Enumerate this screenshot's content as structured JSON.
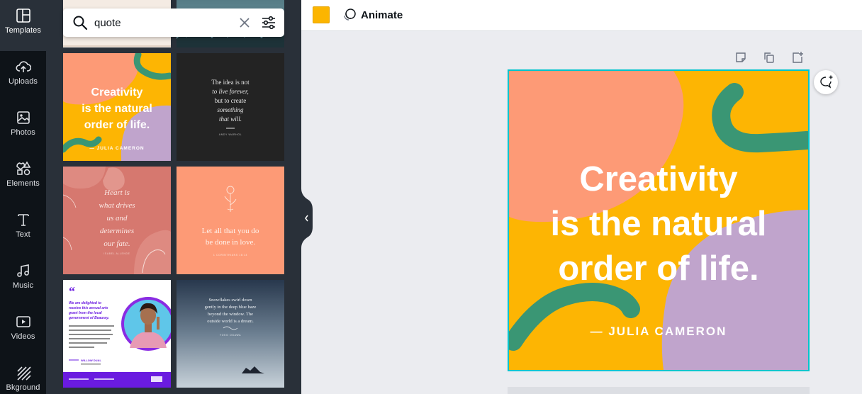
{
  "sidebar": {
    "items": [
      {
        "label": "Templates",
        "icon": "templates-icon"
      },
      {
        "label": "Uploads",
        "icon": "upload-icon"
      },
      {
        "label": "Photos",
        "icon": "photo-icon"
      },
      {
        "label": "Elements",
        "icon": "elements-icon"
      },
      {
        "label": "Text",
        "icon": "text-icon"
      },
      {
        "label": "Music",
        "icon": "music-icon"
      },
      {
        "label": "Videos",
        "icon": "video-icon"
      },
      {
        "label": "Bkground",
        "icon": "background-icon"
      }
    ]
  },
  "search": {
    "value": "quote"
  },
  "templates": [
    {
      "lines": [
        "Creativity",
        "is the natural",
        "order of life."
      ],
      "author": "— JULIA CAMERON"
    },
    {
      "lines": [
        "The idea is not",
        "to live forever,",
        "but to create",
        "something",
        "that will."
      ],
      "author": "ANDY WARHOL"
    },
    {
      "lines": [
        "Heart is",
        "what drives",
        "us and",
        "determines",
        "our fate."
      ],
      "author": "ISABEL ALLENDE"
    },
    {
      "lines": [
        "Let all that you do",
        "be done in love."
      ],
      "author": "1 CORINTHIANS 16:14"
    },
    {
      "lines": [
        "We are delighted to",
        "receive this annual arts",
        "grant from the local",
        "government of Beauray."
      ],
      "author": "WILLOW DUAL"
    },
    {
      "lines": [
        "Snowflakes swirl down",
        "gently in the deep blue haze",
        "beyond the window. The",
        "outside world is a dream."
      ],
      "author": "YOKO OGAWA"
    }
  ],
  "toolbar": {
    "animate_label": "Animate",
    "color": "#fcb500"
  },
  "design": {
    "quote_lines": [
      "Creativity",
      "is the natural",
      "order of life."
    ],
    "author": "— JULIA CAMERON",
    "colors": {
      "coral": "#fd9a76",
      "yellow": "#fdb503",
      "lavender": "#c0a4cc",
      "green": "#3a9674"
    }
  }
}
